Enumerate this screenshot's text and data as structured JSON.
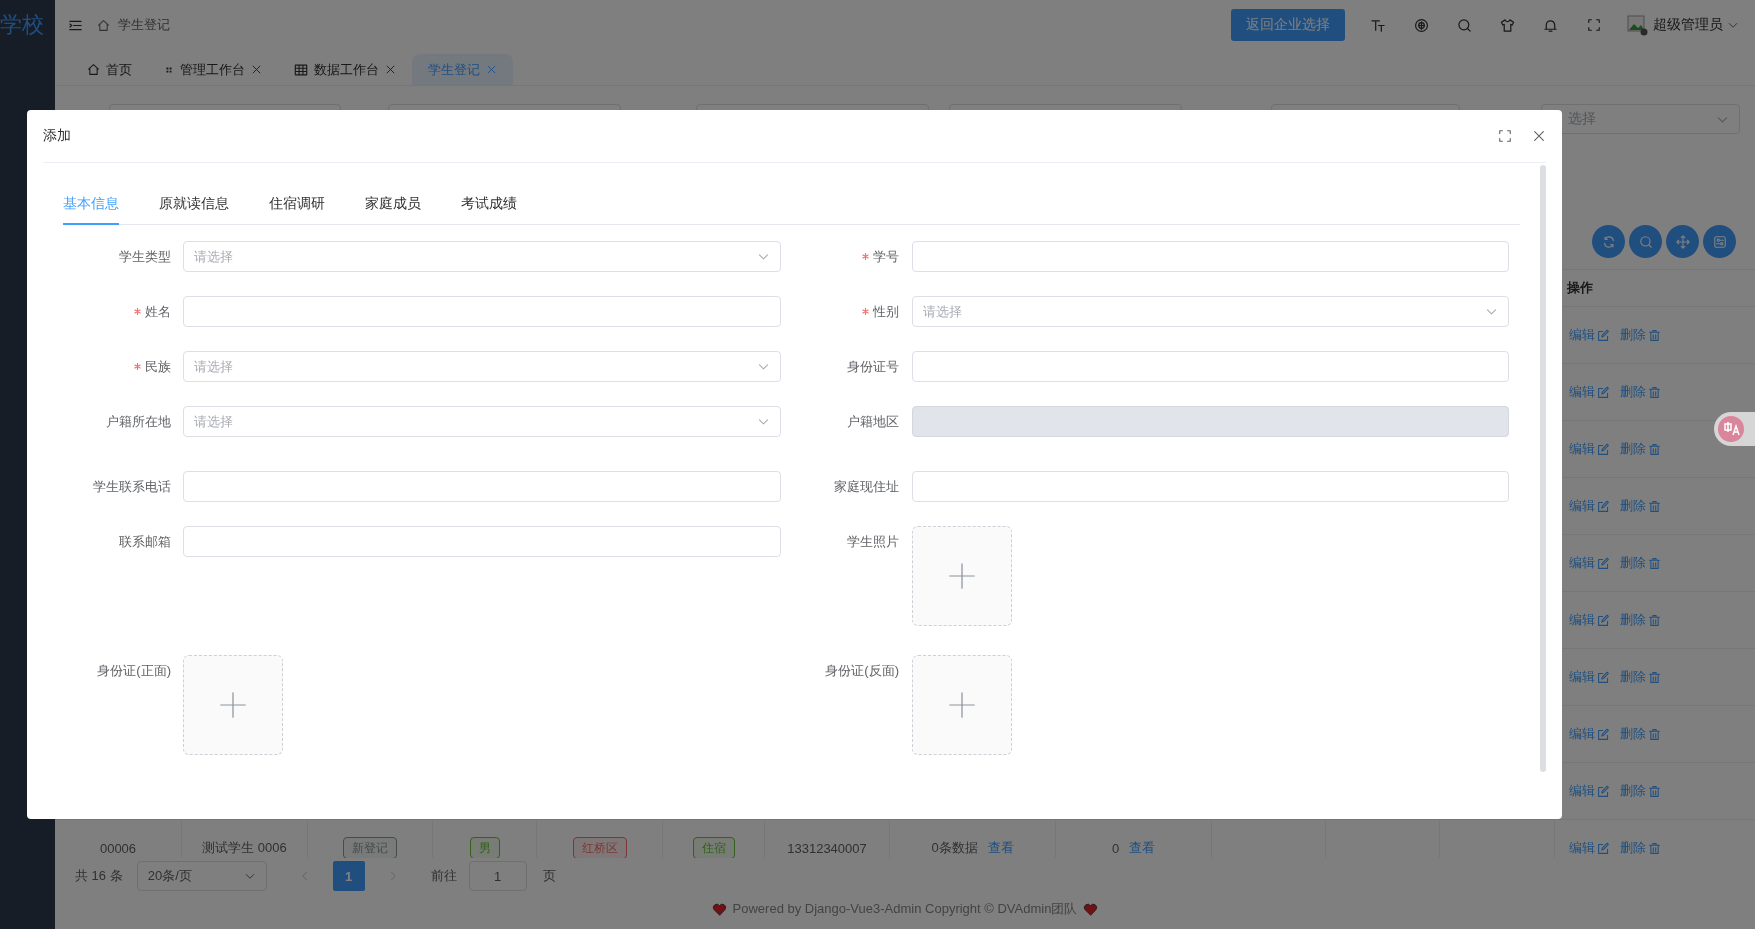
{
  "sidebar": {
    "logo": "学校"
  },
  "header": {
    "breadcrumb": "学生登记",
    "primary_button": "返回企业选择",
    "user": "超级管理员"
  },
  "page_tabs": [
    {
      "label": "首页",
      "closable": false,
      "selected": false
    },
    {
      "label": "管理工作台",
      "closable": true,
      "selected": false
    },
    {
      "label": "数据工作台",
      "closable": true,
      "selected": false
    },
    {
      "label": "学生登记",
      "closable": true,
      "selected": true
    }
  ],
  "filters": [
    {
      "kind": "input"
    },
    {
      "kind": "input"
    },
    {
      "kind": "input"
    },
    {
      "kind": "input"
    },
    {
      "kind": "input"
    },
    {
      "kind": "select",
      "placeholder": "选择"
    }
  ],
  "table": {
    "action_column": "操作",
    "rows": [
      {
        "actions": [
          "编辑",
          "删除"
        ]
      },
      {
        "actions": [
          "编辑",
          "删除"
        ]
      },
      {
        "actions": [
          "编辑",
          "删除"
        ]
      },
      {
        "actions": [
          "编辑",
          "删除"
        ]
      },
      {
        "actions": [
          "编辑",
          "删除"
        ]
      },
      {
        "actions": [
          "编辑",
          "删除"
        ]
      },
      {
        "actions": [
          "编辑",
          "删除"
        ]
      },
      {
        "actions": [
          "编辑",
          "删除"
        ]
      },
      {
        "actions": [
          "编辑",
          "删除"
        ]
      },
      {
        "cells": [
          {
            "kind": "text",
            "text": "00006"
          },
          {
            "kind": "text",
            "text": "测试学生 0006"
          },
          {
            "kind": "tag",
            "text": "新登记",
            "color": "#484a4c"
          },
          {
            "kind": "tag",
            "text": "男",
            "color": "#34611d"
          },
          {
            "kind": "tag",
            "text": "红桥区",
            "color": "#7b3636"
          },
          {
            "kind": "tag",
            "text": "住宿",
            "color": "#34611d"
          },
          {
            "kind": "text",
            "text": "13312340007"
          },
          {
            "kind": "text",
            "text": "0条数据",
            "link": "查看"
          },
          {
            "kind": "text",
            "text": "0",
            "link": "查看"
          }
        ],
        "actions": [
          "编辑",
          "删除"
        ]
      }
    ]
  },
  "pagination": {
    "total": "共 16 条",
    "page_size": "20条/页",
    "pages": [
      {
        "label": "1",
        "selected": true
      }
    ],
    "goto_label": "前往",
    "goto_value": "1",
    "page_suffix": "页"
  },
  "footer": "Powered by Django-Vue3-Admin Copyright © DVAdmin团队",
  "dialog": {
    "title": "添加",
    "tabs": [
      {
        "label": "基本信息",
        "selected": true
      },
      {
        "label": "原就读信息",
        "selected": false
      },
      {
        "label": "住宿调研",
        "selected": false
      },
      {
        "label": "家庭成员",
        "selected": false
      },
      {
        "label": "考试成绩",
        "selected": false
      }
    ],
    "fields": [
      {
        "label": "学生类型",
        "kind": "select",
        "placeholder": "请选择",
        "required": false,
        "disabled": false
      },
      {
        "label": "学号",
        "kind": "input",
        "required": true,
        "disabled": false
      },
      {
        "label": "姓名",
        "kind": "input",
        "required": true,
        "disabled": false
      },
      {
        "label": "性别",
        "kind": "select",
        "placeholder": "请选择",
        "required": true,
        "disabled": false
      },
      {
        "label": "民族",
        "kind": "select",
        "placeholder": "请选择",
        "required": true,
        "disabled": false
      },
      {
        "label": "身份证号",
        "kind": "input",
        "required": false,
        "disabled": false
      },
      {
        "label": "户籍所在地",
        "kind": "select",
        "placeholder": "请选择",
        "required": false,
        "disabled": false
      },
      {
        "label": "户籍地区",
        "kind": "input",
        "required": false,
        "disabled": true
      },
      {
        "label": "学生联系电话",
        "kind": "input",
        "required": false,
        "disabled": false
      },
      {
        "label": "家庭现住址",
        "kind": "input",
        "required": false,
        "disabled": false
      },
      {
        "label": "联系邮箱",
        "kind": "input",
        "required": false,
        "disabled": false
      },
      {
        "label": "学生照片",
        "kind": "upload",
        "required": false
      },
      {
        "label": "身份证(正面)",
        "kind": "upload",
        "required": false
      },
      {
        "label": "身份证(反面)",
        "kind": "upload",
        "required": false
      }
    ]
  }
}
